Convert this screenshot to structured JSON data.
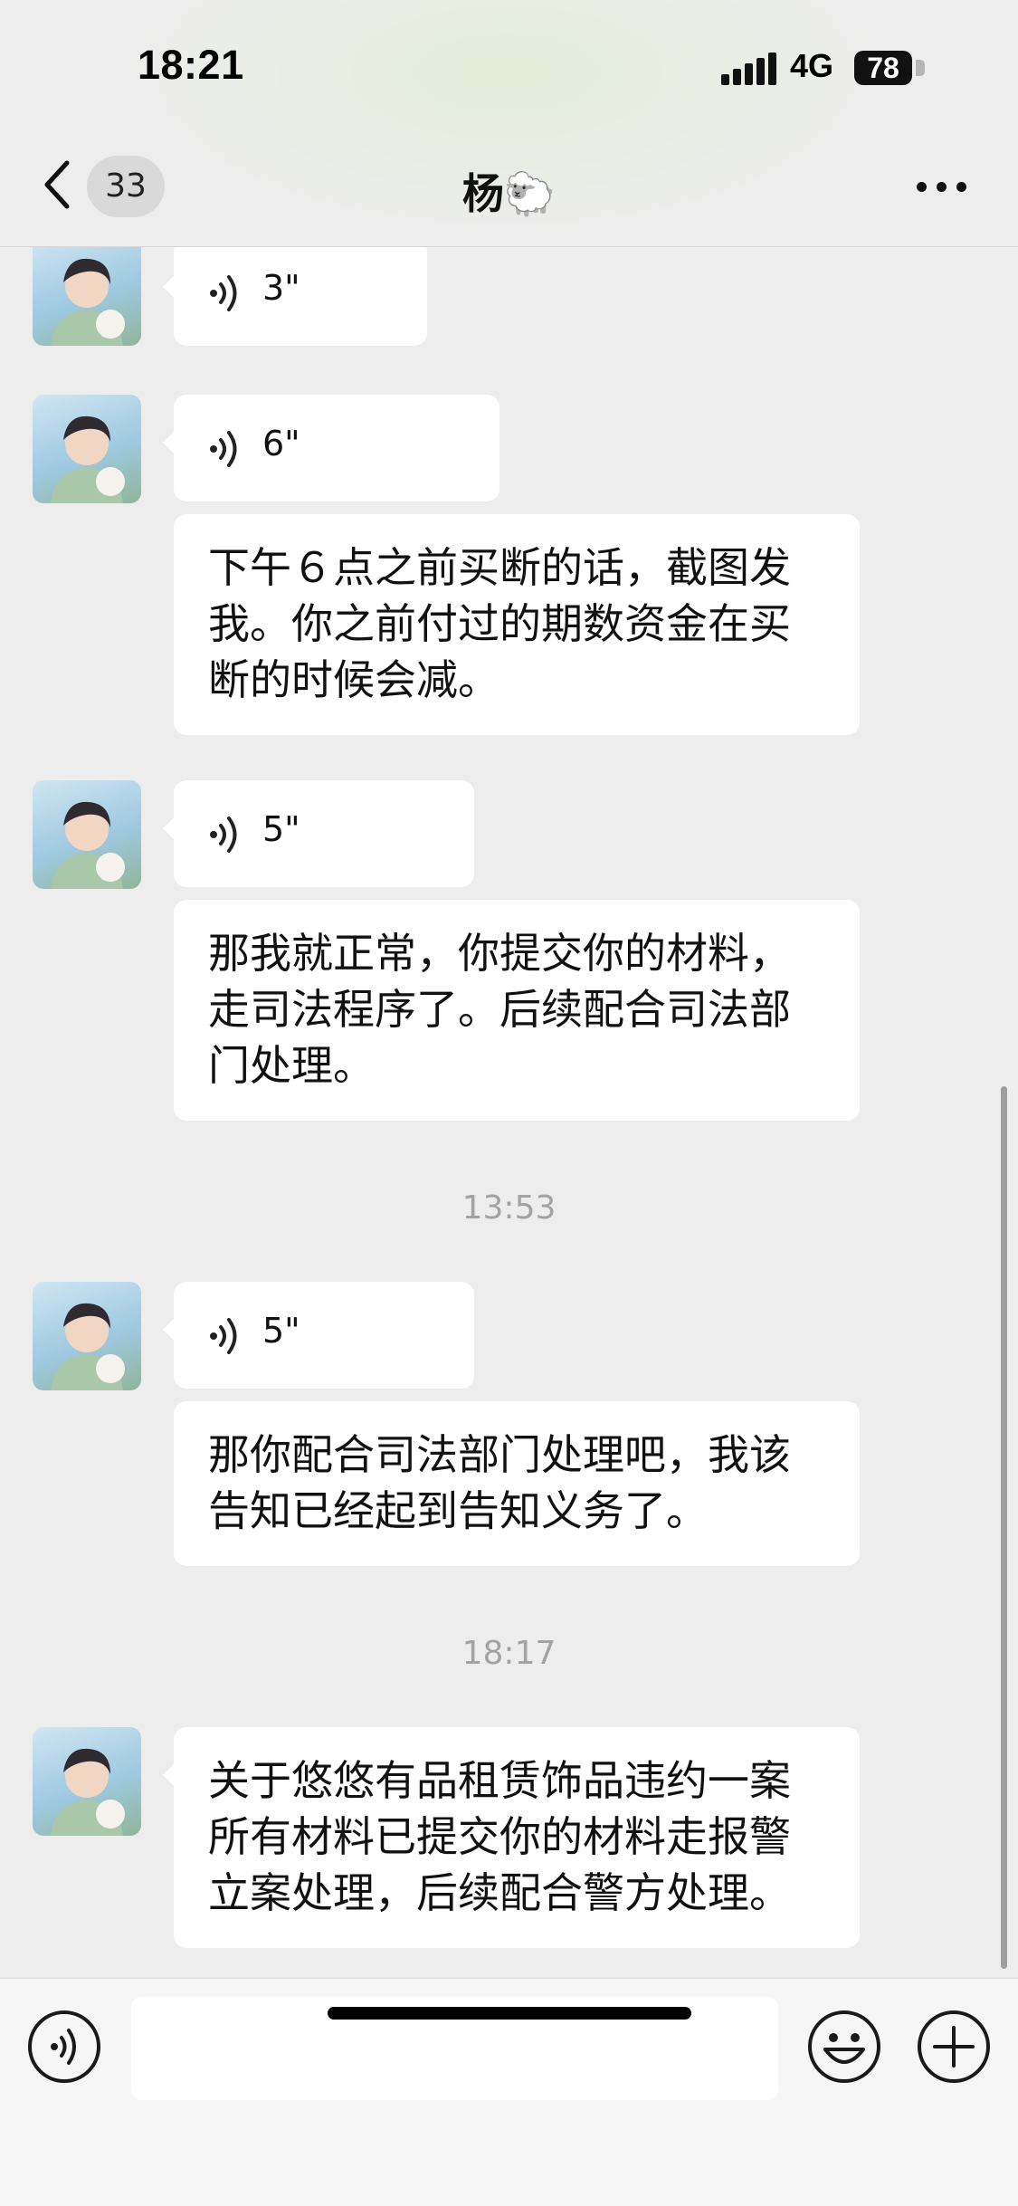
{
  "status_bar": {
    "time": "18:21",
    "network": "4G",
    "battery": "78"
  },
  "header": {
    "unread_count": "33",
    "title": "杨🐑"
  },
  "messages": [
    {
      "type": "voice",
      "duration": "3\""
    },
    {
      "type": "voice",
      "duration": "6\""
    },
    {
      "type": "text",
      "text": "下午６点之前买断的话，截图发我。你之前付过的期数资金在买断的时候会减。"
    },
    {
      "type": "voice",
      "duration": "5\""
    },
    {
      "type": "text",
      "text": "那我就正常，你提交你的材料，走司法程序了。后续配合司法部门处理。"
    },
    {
      "type": "time",
      "text": "13:53"
    },
    {
      "type": "voice",
      "duration": "5\""
    },
    {
      "type": "text",
      "text": "那你配合司法部门处理吧，我该告知已经起到告知义务了。"
    },
    {
      "type": "time",
      "text": "18:17"
    },
    {
      "type": "text",
      "text": "关于悠悠有品租赁饰品违约一案所有材料已提交你的材料走报警立案处理，后续配合警方处理。"
    }
  ],
  "input_bar": {
    "value": "",
    "placeholder": ""
  },
  "icons": {
    "back": "chevron-left-icon",
    "more": "more-dots-icon",
    "voice": "voice-wave-icon",
    "emoji": "emoji-face-icon",
    "plus": "plus-circle-icon"
  },
  "colors": {
    "background": "#ededed",
    "bubble": "#ffffff",
    "timestamp": "#a3a3a3"
  }
}
